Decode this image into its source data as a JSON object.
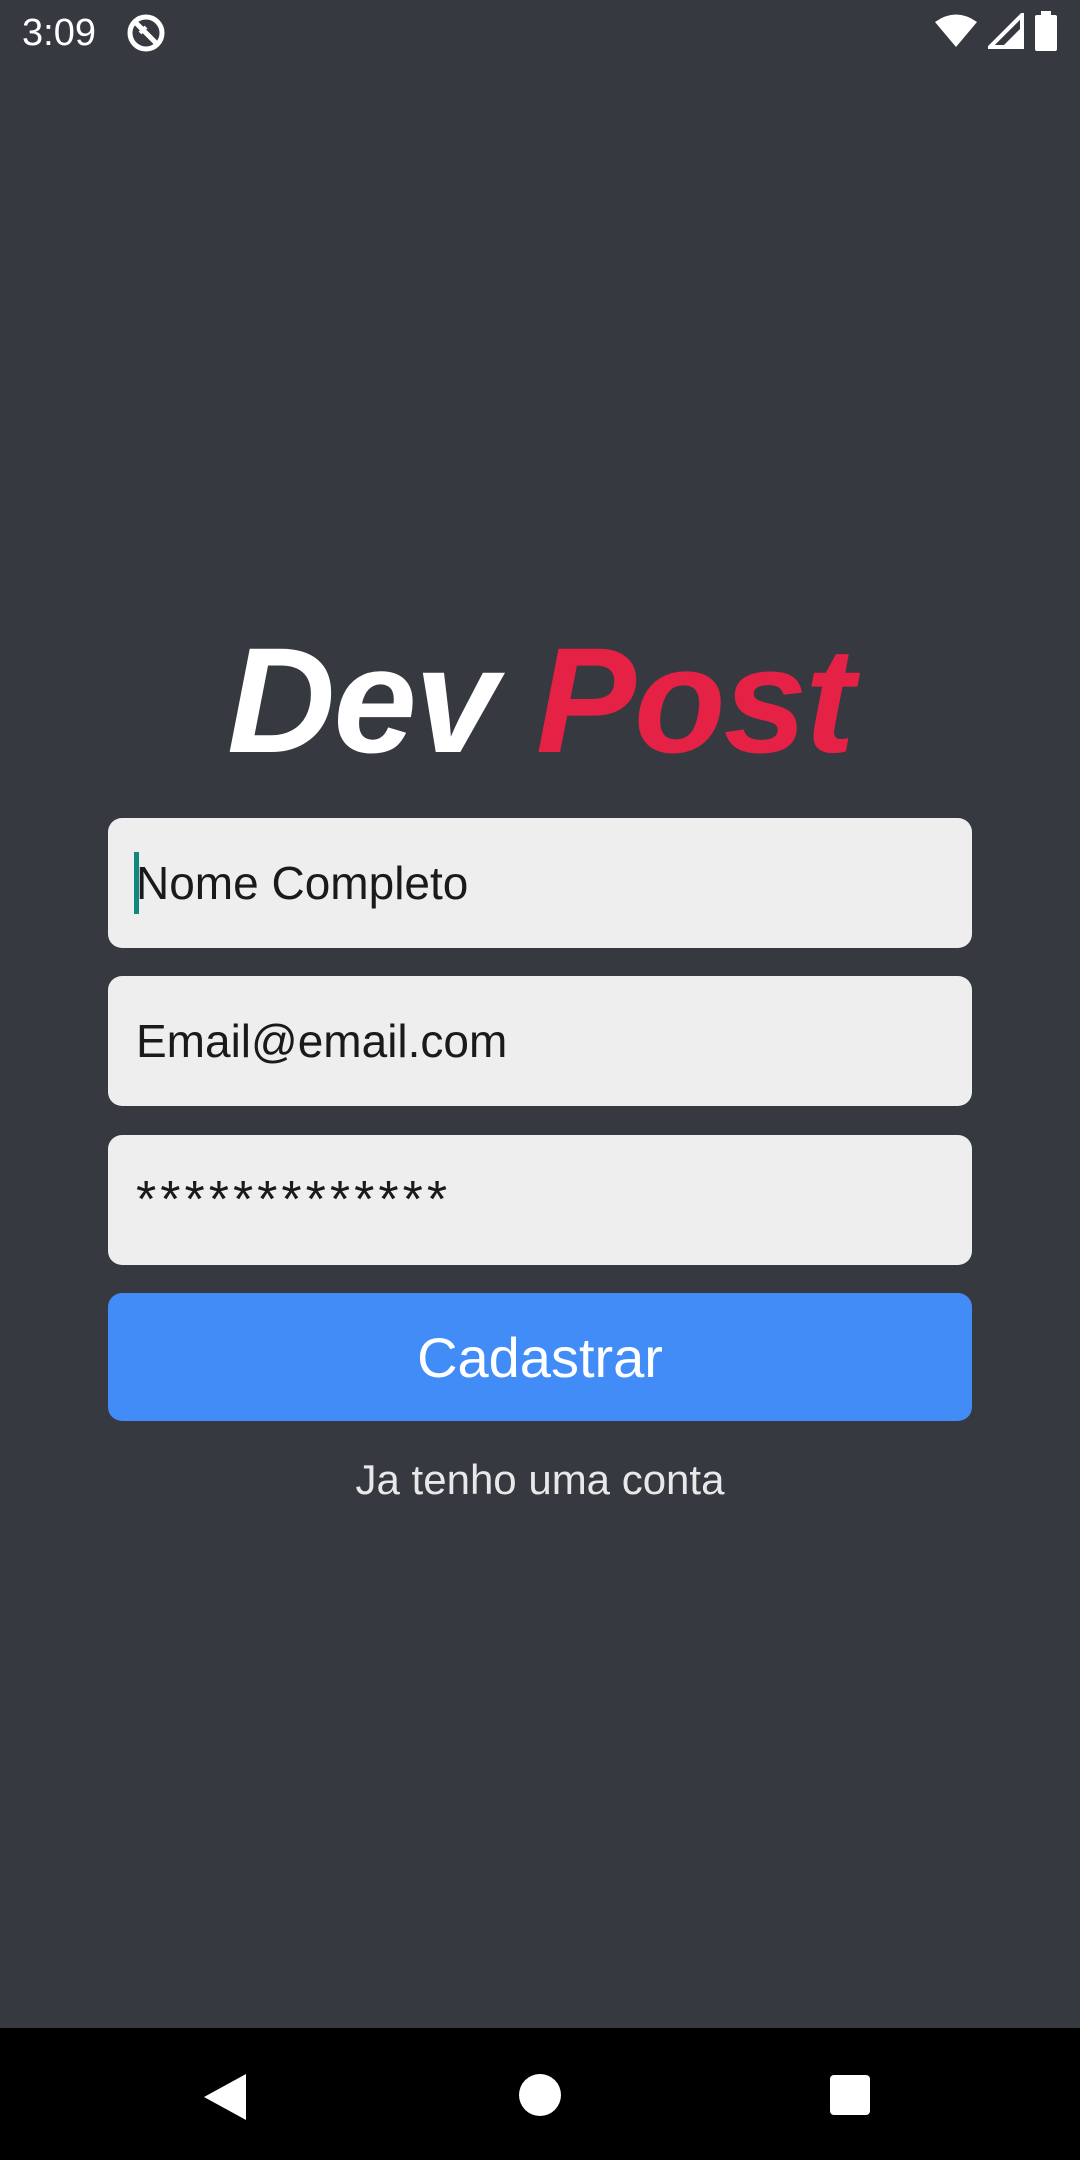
{
  "status_bar": {
    "time": "3:09",
    "icons": [
      "app-notification-icon",
      "wifi-icon",
      "signal-icon",
      "battery-icon"
    ]
  },
  "logo": {
    "part1": "Dev",
    "part2": "Post",
    "part1_color": "#ffffff",
    "part2_color": "#e52145"
  },
  "form": {
    "name_placeholder": "Nome Completo",
    "email_placeholder": "Email@email.com",
    "password_placeholder": "*************",
    "submit_label": "Cadastrar",
    "login_link": "Ja tenho uma conta"
  },
  "navigation": {
    "icons": [
      "back-icon",
      "home-icon",
      "recents-icon"
    ]
  },
  "colors": {
    "background": "#373940",
    "input_background": "#eeeeee",
    "button": "#428cf8",
    "accent": "#e52145",
    "cursor": "#11887b"
  }
}
